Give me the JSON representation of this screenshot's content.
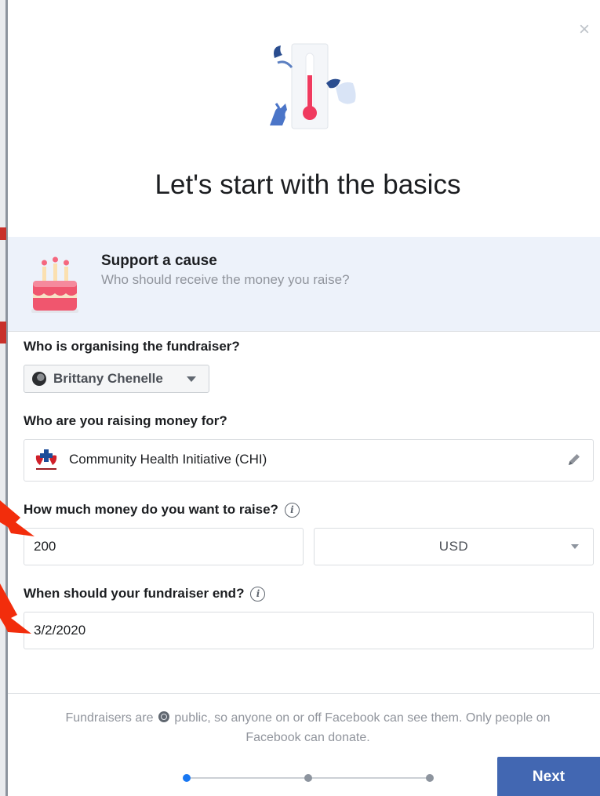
{
  "dialog": {
    "heading": "Let's start with the basics",
    "close_glyph": "×"
  },
  "cause": {
    "title": "Support a cause",
    "subtitle": "Who should receive the money you raise?"
  },
  "organiser": {
    "label": "Who is organising the fundraiser?",
    "name": "Brittany Chenelle"
  },
  "beneficiary": {
    "label": "Who are you raising money for?",
    "name": "Community Health Initiative (CHI)"
  },
  "goal": {
    "label": "How much money do you want to raise?",
    "amount": "200",
    "currency": "USD"
  },
  "end_date": {
    "label": "When should your fundraiser end?",
    "value": "3/2/2020"
  },
  "footer": {
    "notice_pre": "Fundraisers are",
    "notice_post": "public, so anyone on or off Facebook can see them. Only people on Facebook can donate.",
    "next_label": "Next",
    "step_active": 1,
    "step_total": 3
  },
  "colors": {
    "primary_button": "#4267b2",
    "active_step": "#1877f2",
    "cause_bg": "#edf2fa",
    "annotation_arrow": "#f22d0c"
  },
  "icons": [
    "close-icon",
    "fundraiser-illustration",
    "birthday-cake-icon",
    "avatar",
    "dropdown-caret-icon",
    "charity-logo",
    "pencil-edit-icon",
    "info-icon",
    "globe-icon"
  ]
}
